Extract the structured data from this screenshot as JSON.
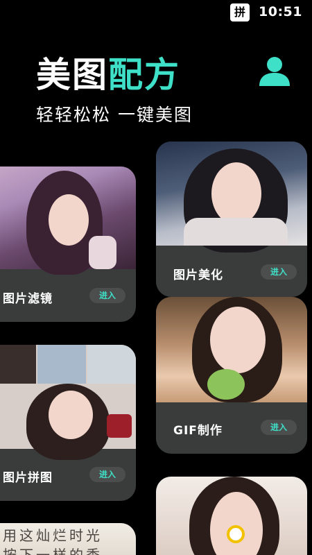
{
  "status_bar": {
    "ime_label": "拼",
    "time": "10:51"
  },
  "header": {
    "title_part1": "美图",
    "title_part2": "配方",
    "subtitle": "轻轻松松 一键美图",
    "user_icon": "user-icon"
  },
  "cards": {
    "filter": {
      "label": "图片滤镜",
      "button": "进入"
    },
    "beautify": {
      "label": "图片美化",
      "button": "进入"
    },
    "collage": {
      "label": "图片拼图",
      "button": "进入"
    },
    "gif": {
      "label": "GIF制作",
      "button": "进入"
    },
    "text_overlay": {
      "visible_text": "用这灿烂时光\n按下一样的季"
    }
  },
  "colors": {
    "accent": "#3fe0c8",
    "background": "#000000",
    "card": "#3a3c3c",
    "button_bg": "#4b4e4d"
  }
}
